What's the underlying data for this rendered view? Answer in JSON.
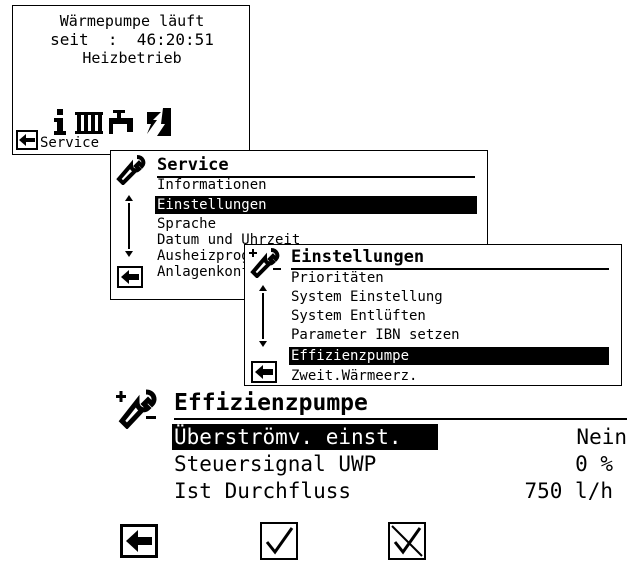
{
  "status_screen": {
    "line1": "Wärmepumpe läuft",
    "line2": "seit  :  46:20:51",
    "line3": "Heizbetrieb",
    "bottom_label": "Service",
    "icons": [
      "info-icon",
      "radiator-icon",
      "faucet-icon",
      "power-icon"
    ]
  },
  "service_menu": {
    "title": "Service",
    "items": [
      "Informationen",
      "Einstellungen",
      "Sprache",
      "Datum und Uhrzeit",
      "Ausheizprogramm",
      "Anlagenkonfiguration"
    ],
    "selected_index": 1
  },
  "settings_menu": {
    "title": "Einstellungen",
    "items": [
      "Prioritäten",
      "System Einstellung",
      "System Entlüften",
      "Parameter IBN setzen",
      "Effizienzpumpe",
      "Zweit.Wärmeerz."
    ],
    "selected_index": 4
  },
  "pump_screen": {
    "title": "Effizienzpumpe",
    "rows": [
      {
        "label": "Überströmv. einst.",
        "value": "Nein",
        "selected": true
      },
      {
        "label": "Steuersignal UWP",
        "value": "0 %",
        "selected": false
      },
      {
        "label": "Ist Durchfluss",
        "value": "750 l/h",
        "selected": false
      }
    ],
    "buttons": [
      "back-arrow-icon",
      "checkmark-icon",
      "cancel-check-icon"
    ]
  }
}
